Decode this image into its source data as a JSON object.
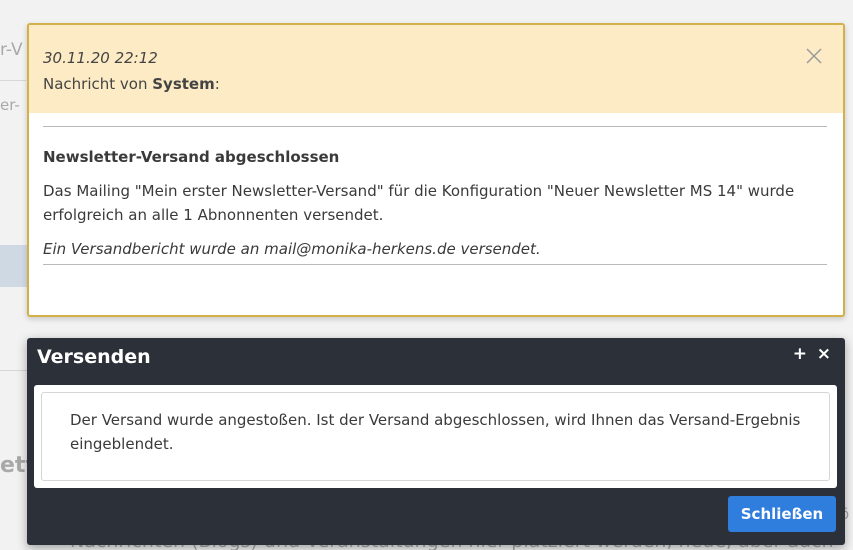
{
  "background": {
    "fragment_1": "r-V",
    "fragment_2": "er-",
    "fragment_3": "ett",
    "fragment_4": "Nachrichten (Blogs) und Veranstaltungen hier platziert werden, neue, aber auch",
    "fragment_5": "ö"
  },
  "notification": {
    "timestamp": "30.11.20 22:12",
    "from_prefix": "Nachricht von ",
    "sender": "System",
    "from_suffix": ":",
    "close_icon": "close-x-icon",
    "subject": "Newsletter-Versand abgeschlossen",
    "text": "Das Mailing \"Mein erster Newsletter-Versand\" für die Konfiguration \"Neuer Newsletter MS 14\" wurde erfolgreich an alle 1 Abnonnenten versendet.",
    "note": "Ein Versandbericht wurde an mail@monika-herkens.de versendet.",
    "colors": {
      "header_bg": "#fcebc4",
      "border": "#d4b04a"
    }
  },
  "dialog": {
    "title": "Versenden",
    "maximize_label": "+",
    "close_label": "×",
    "message": "Der Versand wurde angestoßen. Ist der Versand abgeschlossen, wird Ihnen das Versand-Ergebnis eingeblendet.",
    "close_button_label": "Schließen",
    "colors": {
      "titlebar_bg": "#2b3039",
      "button_bg": "#2f7ddd"
    }
  }
}
